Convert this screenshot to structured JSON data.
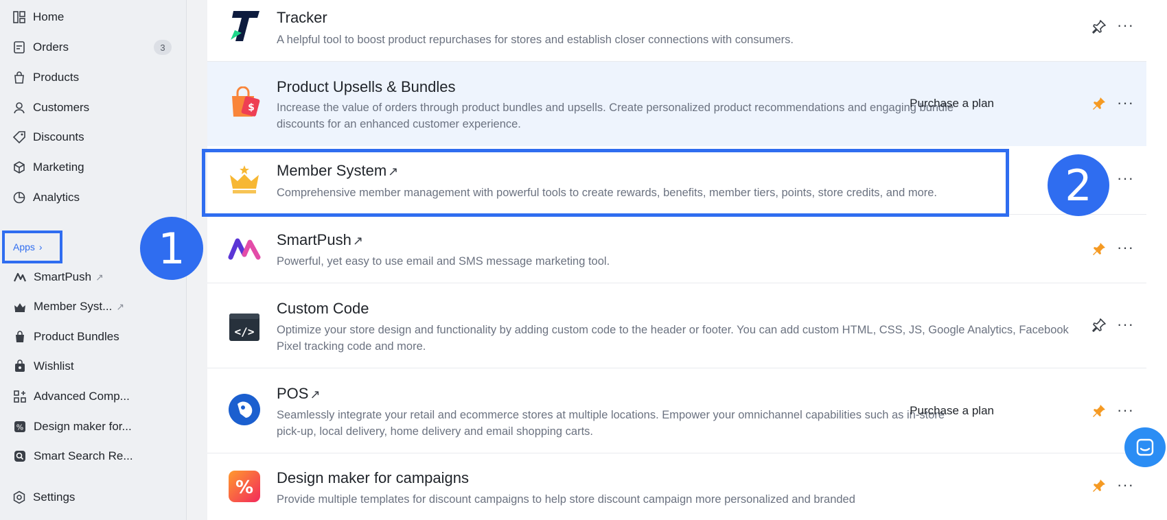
{
  "sidebar": {
    "nav": [
      {
        "label": "Home",
        "icon": "home-icon"
      },
      {
        "label": "Orders",
        "icon": "orders-icon",
        "badge": "3"
      },
      {
        "label": "Products",
        "icon": "products-icon"
      },
      {
        "label": "Customers",
        "icon": "customers-icon"
      },
      {
        "label": "Discounts",
        "icon": "discounts-icon"
      },
      {
        "label": "Marketing",
        "icon": "marketing-icon"
      },
      {
        "label": "Analytics",
        "icon": "analytics-icon"
      }
    ],
    "apps_label": "Apps",
    "apps": [
      {
        "label": "SmartPush",
        "icon": "smartpush-icon",
        "external": true
      },
      {
        "label": "Member Syst...",
        "icon": "crown-icon",
        "external": true
      },
      {
        "label": "Product Bundles",
        "icon": "bundles-icon"
      },
      {
        "label": "Wishlist",
        "icon": "wishlist-icon"
      },
      {
        "label": "Advanced Comp...",
        "icon": "grid-icon"
      },
      {
        "label": "Design maker for...",
        "icon": "percent-icon"
      },
      {
        "label": "Smart Search Re...",
        "icon": "search-icon"
      }
    ],
    "settings_label": "Settings"
  },
  "steps": {
    "one": "1",
    "two": "2"
  },
  "apps_list": [
    {
      "title": "Tracker",
      "desc": "A helpful tool to boost product repurchases for stores and establish closer connections with consumers.",
      "plan": "",
      "pinned": false
    },
    {
      "title": "Product Upsells & Bundles",
      "desc": "Increase the value of orders through product bundles and upsells. Create personalized product recommendations and engaging bundle discounts for an enhanced customer experience.",
      "plan": "Purchase a plan",
      "pinned": true
    },
    {
      "title": "Member System",
      "desc": "Comprehensive member management with powerful tools to create rewards, benefits, member tiers, points, store credits, and more.",
      "plan": "",
      "pinned": false
    },
    {
      "title": "SmartPush",
      "desc": "Powerful, yet easy to use email and SMS message marketing tool.",
      "plan": "",
      "pinned": true
    },
    {
      "title": "Custom Code",
      "desc": "Optimize your store design and functionality by adding custom code to the header or footer. You can add custom HTML, CSS, JS, Google Analytics, Facebook Pixel tracking code and more.",
      "plan": "",
      "pinned": false
    },
    {
      "title": "POS",
      "desc": "Seamlessly integrate your retail and ecommerce stores at multiple locations. Empower your omnichannel capabilities such as in-store pick-up, local delivery, home delivery and email shopping carts.",
      "plan": "Purchase a plan",
      "pinned": true
    },
    {
      "title": "Design maker for campaigns",
      "desc": "Provide multiple templates for discount campaigns to help store discount campaign more personalized and branded",
      "plan": "",
      "pinned": true
    }
  ],
  "more_label": "···",
  "colors": {
    "accent": "#2f6df0",
    "pin_active": "#f59a23",
    "highlight_row": "#eef4fd"
  }
}
